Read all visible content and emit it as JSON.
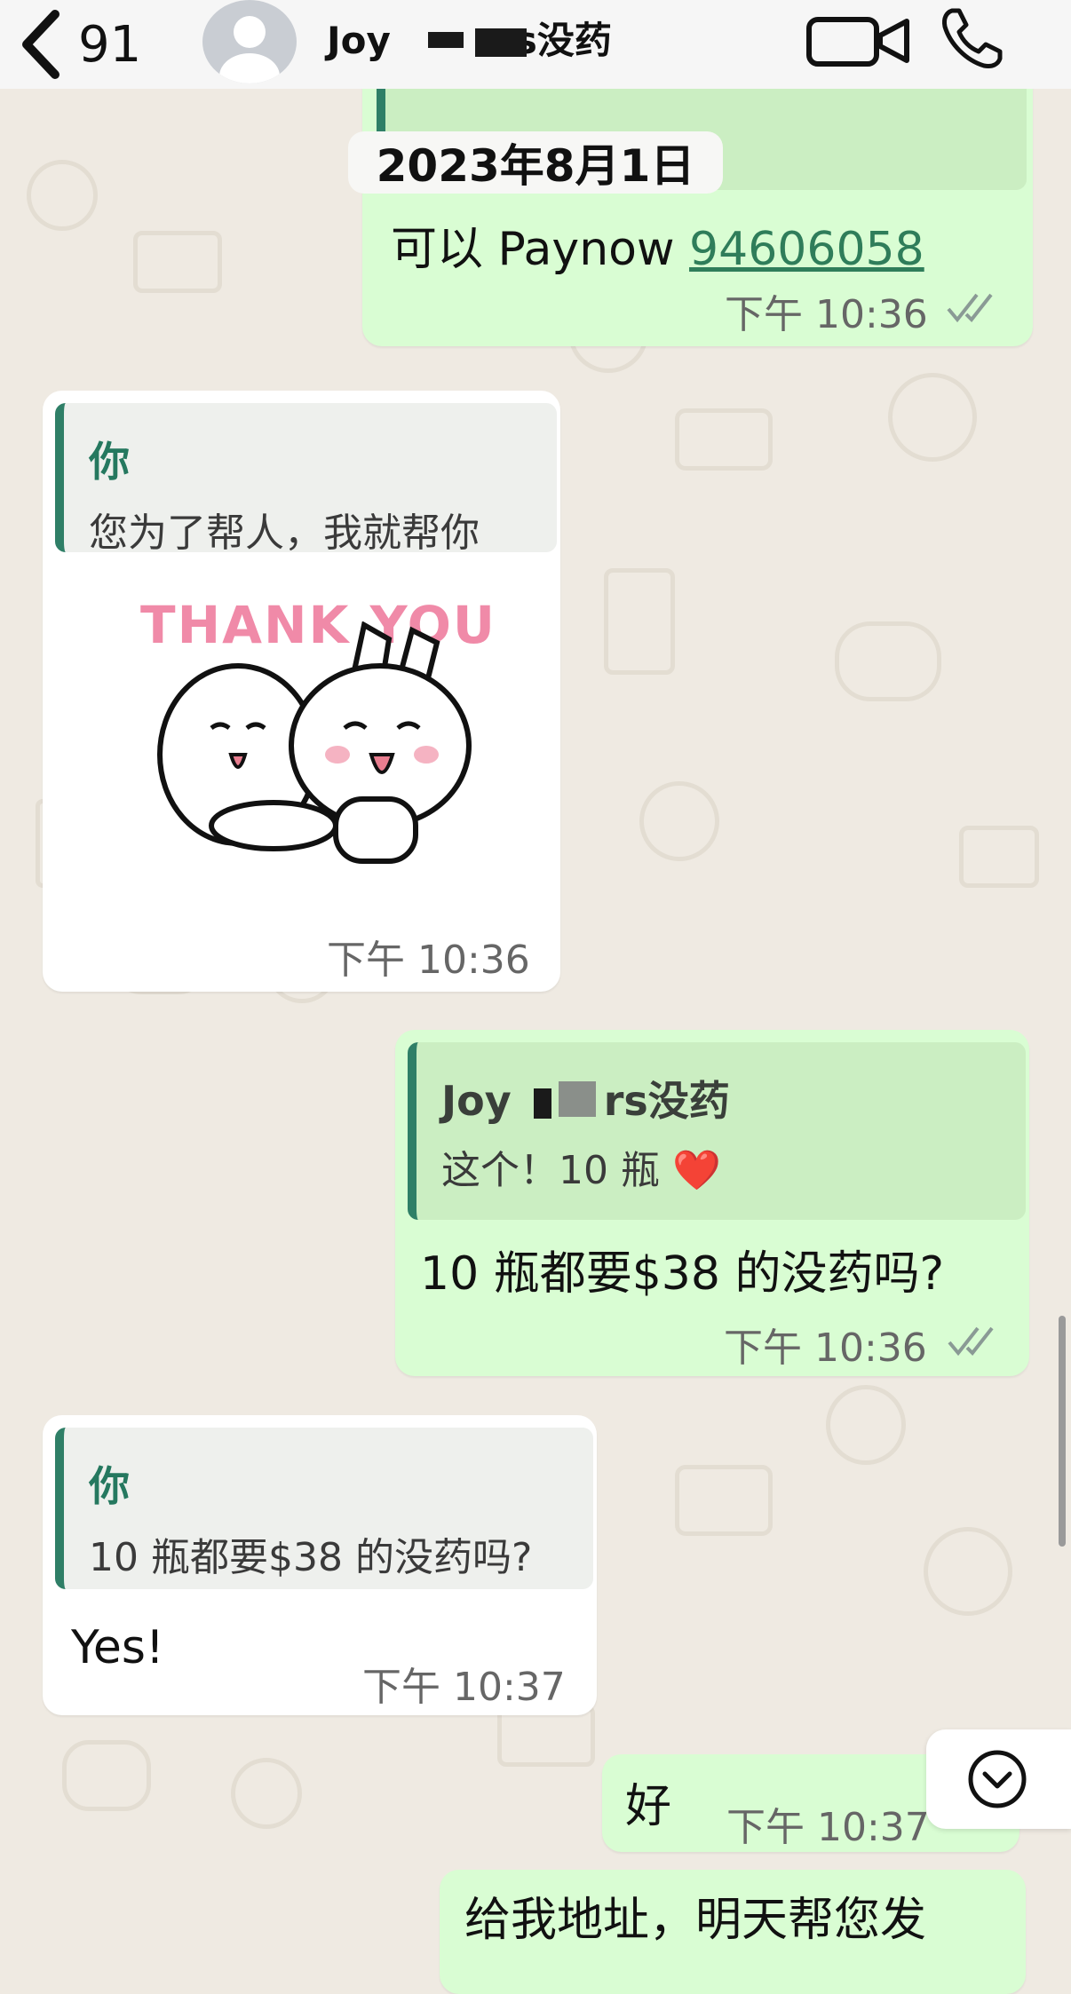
{
  "header": {
    "back_count": "91",
    "contact_name_start": "Joy",
    "contact_name_end": "s没药",
    "icons": [
      "back-chevron-icon",
      "avatar-person-icon",
      "video-camera-icon",
      "phone-icon"
    ]
  },
  "date_chip": "2023年8月1日",
  "messages": {
    "m1": {
      "text_prefix": "可以 Paynow ",
      "link": "94606058",
      "time": "下午 10:36"
    },
    "m2": {
      "quote_name": "你",
      "quote_text": "您为了帮人，我就帮你",
      "sticker_text": "THANK YOU",
      "time": "下午 10:36"
    },
    "m3": {
      "quote_name_start": "Joy",
      "quote_name_end": "rs没药",
      "quote_text": "这个！10 瓶",
      "quote_emoji": "❤️",
      "text": "10 瓶都要$38 的没药吗?",
      "time": "下午 10:36"
    },
    "m4": {
      "quote_name": "你",
      "quote_text": "10 瓶都要$38 的没药吗?",
      "text": "Yes!",
      "time": "下午 10:37"
    },
    "m5": {
      "text": "好",
      "time": "下午 10:37"
    },
    "m6": {
      "text": "给我地址，明天帮您发"
    }
  },
  "colors": {
    "outgoing_bubble": "#d9fdd3",
    "incoming_bubble": "#ffffff",
    "accent_green": "#25785f",
    "read_tick": "#8a9a95",
    "chat_background": "#efeae2"
  }
}
